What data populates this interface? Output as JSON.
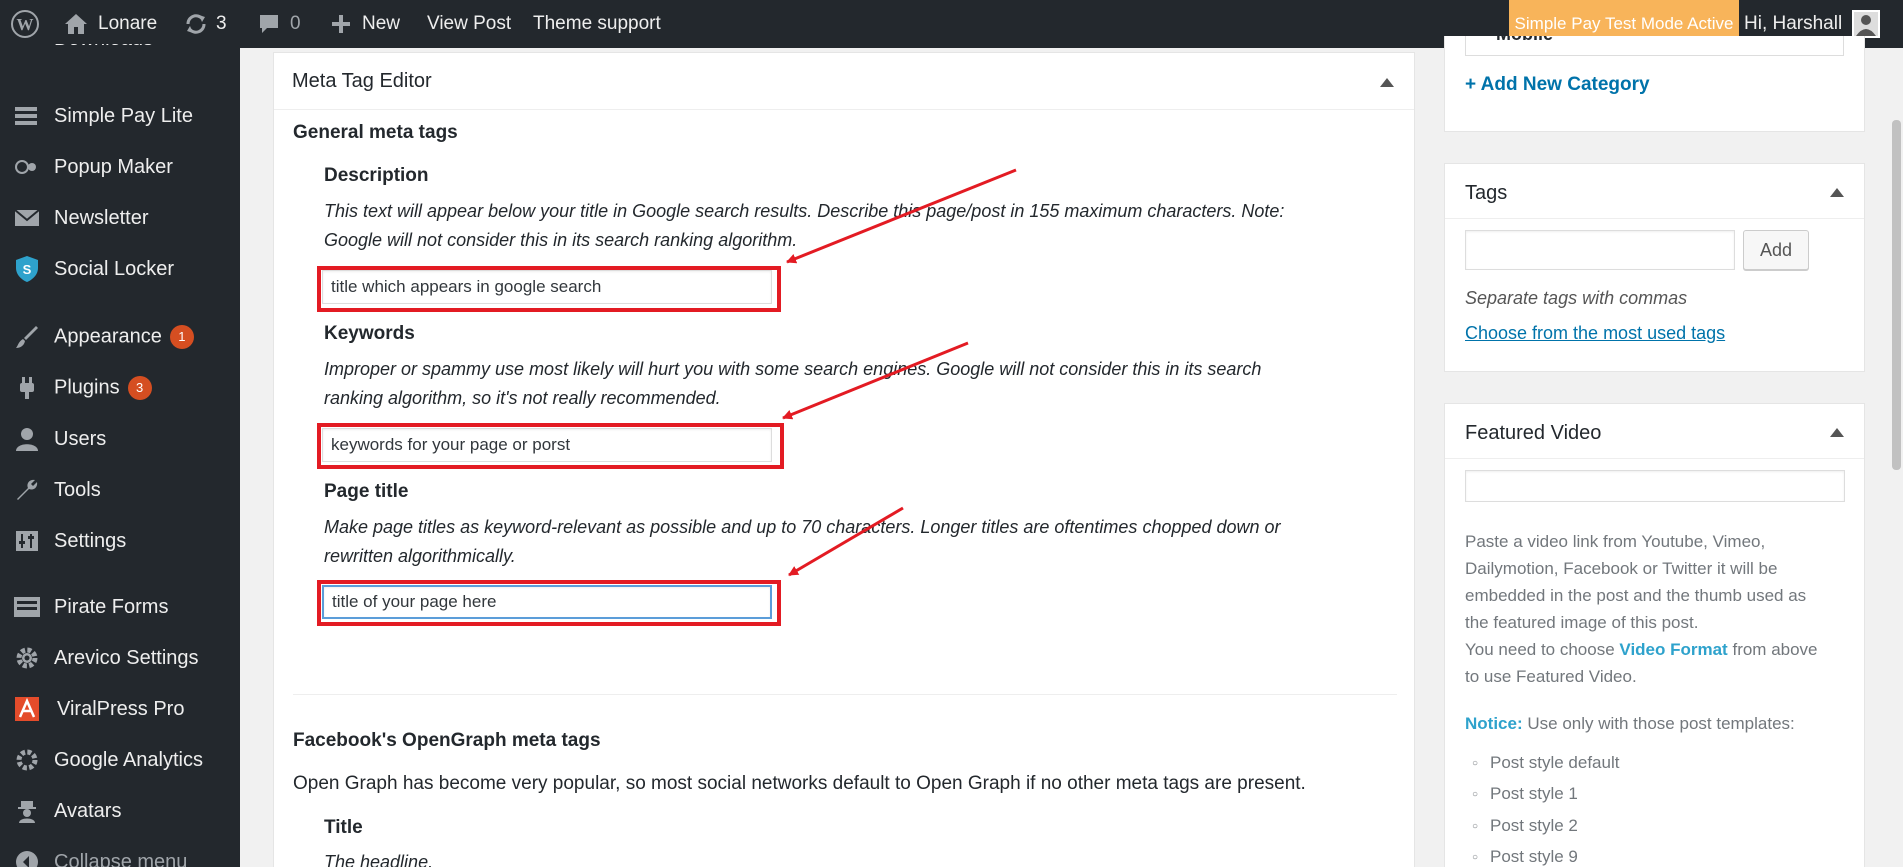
{
  "adminbar": {
    "site_name": "Lonare",
    "updates_count": "3",
    "comments_count": "0",
    "new_label": "New",
    "view_post": "View Post",
    "theme_support": "Theme support",
    "test_mode": "Simple Pay Test Mode Active",
    "greeting": "Hi, Harshall"
  },
  "sidebar": {
    "items": [
      {
        "label": "Simple Pay Lite",
        "icon": "simple-pay-icon"
      },
      {
        "label": "Popup Maker",
        "icon": "popup-maker-icon"
      },
      {
        "label": "Newsletter",
        "icon": "envelope-icon"
      },
      {
        "label": "Social Locker",
        "icon": "shield-icon"
      },
      {
        "label": "Appearance",
        "icon": "paintbrush-icon",
        "badge": "1"
      },
      {
        "label": "Plugins",
        "icon": "plug-icon",
        "badge": "3"
      },
      {
        "label": "Users",
        "icon": "user-icon"
      },
      {
        "label": "Tools",
        "icon": "wrench-icon"
      },
      {
        "label": "Settings",
        "icon": "sliders-icon"
      },
      {
        "label": "Pirate Forms",
        "icon": "form-icon"
      },
      {
        "label": "Arevico Settings",
        "icon": "gear-icon"
      },
      {
        "label": "ViralPress Pro",
        "icon": "viralpress-icon"
      },
      {
        "label": "Google Analytics",
        "icon": "analytics-icon"
      },
      {
        "label": "Avatars",
        "icon": "avatar-icon"
      }
    ],
    "collapse": "Collapse menu"
  },
  "meta_editor": {
    "title": "Meta Tag Editor",
    "general_heading": "General meta tags",
    "description": {
      "label": "Description",
      "help_line1": "This text will appear below your title in Google search results. Describe this page/post in 155 maximum characters. Note:",
      "help_line2": "Google will not consider this in its search ranking algorithm.",
      "value": "title which appears in google search"
    },
    "keywords": {
      "label": "Keywords",
      "help_line1": "Improper or spammy use most likely will hurt you with some search engines. Google will not consider this in its search",
      "help_line2": "ranking algorithm, so it's not really recommended.",
      "value": "keywords for your page or porst"
    },
    "page_title": {
      "label": "Page title",
      "help_line1": "Make page titles as keyword-relevant as possible and up to 70 characters. Longer titles are oftentimes chopped down or",
      "help_line2": "rewritten algorithmically.",
      "value": "title of your page here"
    },
    "og_heading": "Facebook's OpenGraph meta tags",
    "og_text": "Open Graph has become very popular, so most social networks default to Open Graph if no other meta tags are present.",
    "og_title_label": "Title",
    "og_title_help": "The headline."
  },
  "categories": {
    "add_new": "+ Add New Category",
    "partial_item": "Mobile"
  },
  "tags": {
    "title": "Tags",
    "add_button": "Add",
    "hint": "Separate tags with commas",
    "choose_link": "Choose from the most used tags"
  },
  "featured_video": {
    "title": "Featured Video",
    "help_lines": [
      "Paste a video link from Youtube, Vimeo,",
      "Dailymotion, Facebook or Twitter it will be",
      "embedded in the post and the thumb used as",
      "the featured image of this post."
    ],
    "need_prefix": "You need to choose",
    "need_link": "Video Format",
    "need_suffix": "from above",
    "need_line2": "to use Featured Video.",
    "notice_label": "Notice:",
    "notice_text": "Use only with those post templates:",
    "templates": [
      "Post style default",
      "Post style 1",
      "Post style 2",
      "Post style 9"
    ]
  },
  "colors": {
    "adminbar_bg": "#23282d",
    "highlight": "#e31b23",
    "link": "#0073aa",
    "test_mode_bg": "#f8b45a",
    "badge": "#d54e21"
  }
}
